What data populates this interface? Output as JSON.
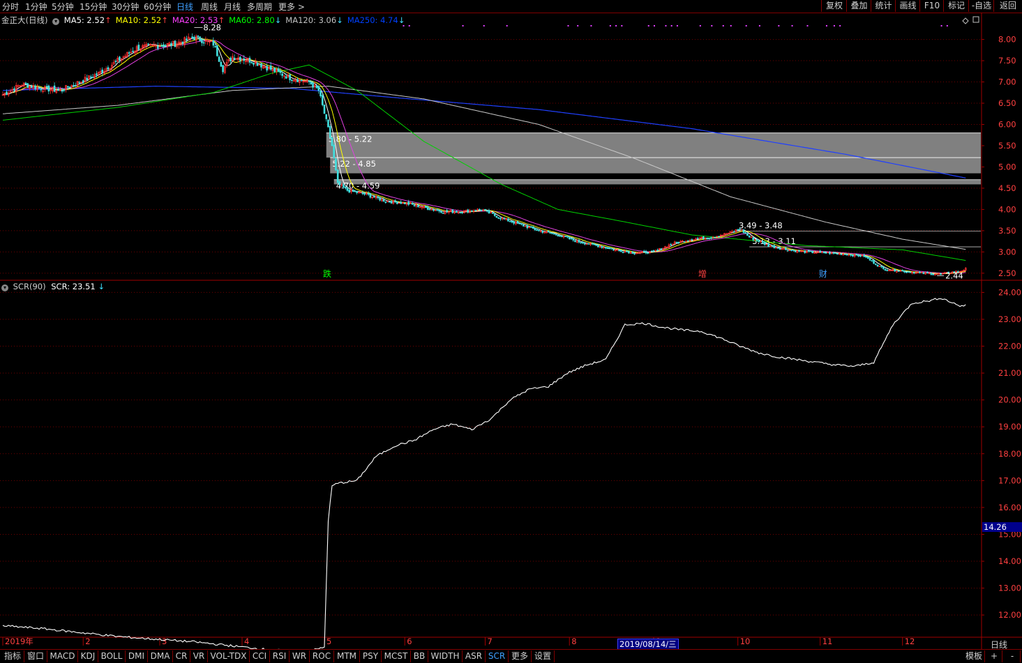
{
  "periods": [
    "分时",
    "1分钟",
    "5分钟",
    "15分钟",
    "30分钟",
    "60分钟",
    "日线",
    "周线",
    "月线",
    "多周期",
    "更多 >"
  ],
  "active_period": "日线",
  "right_buttons": [
    "复权",
    "叠加",
    "统计",
    "画线",
    "F10",
    "标记",
    "-自选",
    "返回"
  ],
  "chart_title": "金正大(日线)",
  "ma_legend": [
    {
      "label": "MA5: 2.52",
      "arrow": "↑",
      "color": "#ffffff"
    },
    {
      "label": "MA10: 2.52",
      "arrow": "↑",
      "color": "#ffff00"
    },
    {
      "label": "MA20: 2.53",
      "arrow": "↑",
      "color": "#ff40ff"
    },
    {
      "label": "MA60: 2.80",
      "arrow": "↓",
      "color": "#00ff00"
    },
    {
      "label": "MA120: 3.06",
      "arrow": "↓",
      "color": "#c0c0c0"
    },
    {
      "label": "MA250: 4.74",
      "arrow": "↓",
      "color": "#0040ff"
    }
  ],
  "indicator_legend": {
    "name": "SCR(90)",
    "value": "SCR: 23.51",
    "arrow": "↓"
  },
  "current_value_tag": "14.26",
  "cursor_date": "2019/08/14/三",
  "bottom_right_label": "日线",
  "tabs": [
    "指标",
    "窗口",
    "MACD",
    "KDJ",
    "BOLL",
    "DMI",
    "DMA",
    "CR",
    "VR",
    "VOL-TDX",
    "CCI",
    "RSI",
    "WR",
    "ROC",
    "MTM",
    "PSY",
    "MCST",
    "BB",
    "WIDTH",
    "ASR",
    "SCR",
    "更多",
    "设置"
  ],
  "active_tab": "SCR",
  "tabs_right": [
    "模板",
    "+",
    "-"
  ],
  "chart_data": [
    {
      "type": "candlestick",
      "title": "金正大(日线)",
      "y_ticks": [
        2.5,
        3.0,
        3.5,
        4.0,
        4.5,
        5.0,
        5.5,
        6.0,
        6.5,
        7.0,
        7.5,
        8.0
      ],
      "ylim": [
        2.35,
        8.6
      ],
      "high_annotation": "8.28",
      "low_annotation": "2.44",
      "gap_zones": [
        {
          "label": "5.80 - 5.22",
          "high": 5.8,
          "low": 5.22
        },
        {
          "label": "5.22 - 4.85",
          "high": 5.22,
          "low": 4.85
        },
        {
          "label": "4.70 - 4.59",
          "high": 4.7,
          "low": 4.59
        }
      ],
      "level_lines": [
        {
          "label": "3.49 - 3.48",
          "value": 3.49
        },
        {
          "label": "3.13 - 3.11",
          "value": 3.12
        }
      ],
      "event_markers": [
        {
          "label": "跌",
          "color": "#00ff00"
        },
        {
          "label": "增",
          "color": "#ff4040"
        },
        {
          "label": "财",
          "color": "#40a0ff"
        }
      ],
      "x_months": [
        "2019年",
        "2",
        "3",
        "4",
        "5",
        "6",
        "7",
        "8",
        "9",
        "10",
        "11",
        "12"
      ],
      "close_anchors": [
        [
          0,
          6.7
        ],
        [
          10,
          6.95
        ],
        [
          20,
          6.85
        ],
        [
          30,
          6.8
        ],
        [
          40,
          7.0
        ],
        [
          50,
          7.2
        ],
        [
          60,
          7.5
        ],
        [
          70,
          7.8
        ],
        [
          80,
          7.85
        ],
        [
          90,
          7.9
        ],
        [
          100,
          8.05
        ],
        [
          110,
          7.9
        ],
        [
          115,
          7.3
        ],
        [
          120,
          7.6
        ],
        [
          130,
          7.5
        ],
        [
          140,
          7.3
        ],
        [
          150,
          7.1
        ],
        [
          160,
          7.0
        ],
        [
          165,
          6.8
        ],
        [
          170,
          5.9
        ],
        [
          172,
          5.5
        ],
        [
          175,
          4.6
        ],
        [
          180,
          4.45
        ],
        [
          190,
          4.35
        ],
        [
          200,
          4.2
        ],
        [
          210,
          4.15
        ],
        [
          220,
          4.05
        ],
        [
          230,
          3.95
        ],
        [
          240,
          3.95
        ],
        [
          250,
          4.0
        ],
        [
          260,
          3.8
        ],
        [
          270,
          3.65
        ],
        [
          280,
          3.5
        ],
        [
          290,
          3.4
        ],
        [
          300,
          3.25
        ],
        [
          310,
          3.15
        ],
        [
          320,
          3.05
        ],
        [
          330,
          2.98
        ],
        [
          340,
          3.0
        ],
        [
          350,
          3.2
        ],
        [
          360,
          3.3
        ],
        [
          370,
          3.35
        ],
        [
          380,
          3.45
        ],
        [
          385,
          3.55
        ],
        [
          390,
          3.35
        ],
        [
          400,
          3.15
        ],
        [
          410,
          3.05
        ],
        [
          420,
          3.0
        ],
        [
          430,
          2.98
        ],
        [
          440,
          2.95
        ],
        [
          450,
          2.9
        ],
        [
          455,
          2.75
        ],
        [
          460,
          2.6
        ],
        [
          470,
          2.55
        ],
        [
          480,
          2.5
        ],
        [
          490,
          2.48
        ],
        [
          500,
          2.55
        ],
        [
          503,
          2.6
        ]
      ],
      "ma250_anchors": [
        [
          0,
          6.8
        ],
        [
          80,
          6.9
        ],
        [
          150,
          6.85
        ],
        [
          200,
          6.65
        ],
        [
          280,
          6.35
        ],
        [
          360,
          5.9
        ],
        [
          440,
          5.3
        ],
        [
          503,
          4.74
        ]
      ],
      "ma120_anchors": [
        [
          0,
          6.25
        ],
        [
          60,
          6.45
        ],
        [
          120,
          6.8
        ],
        [
          170,
          6.9
        ],
        [
          220,
          6.6
        ],
        [
          280,
          6.0
        ],
        [
          330,
          5.2
        ],
        [
          380,
          4.3
        ],
        [
          430,
          3.7
        ],
        [
          470,
          3.3
        ],
        [
          503,
          3.06
        ]
      ],
      "ma60_anchors": [
        [
          0,
          6.1
        ],
        [
          60,
          6.4
        ],
        [
          110,
          6.75
        ],
        [
          140,
          7.2
        ],
        [
          160,
          7.4
        ],
        [
          185,
          6.8
        ],
        [
          220,
          5.6
        ],
        [
          260,
          4.6
        ],
        [
          290,
          4.0
        ],
        [
          320,
          3.75
        ],
        [
          360,
          3.4
        ],
        [
          420,
          3.15
        ],
        [
          470,
          3.05
        ],
        [
          503,
          2.8
        ]
      ]
    },
    {
      "type": "line",
      "title": "SCR(90)",
      "y_ticks": [
        12.0,
        13.0,
        14.0,
        15.0,
        16.0,
        17.0,
        18.0,
        19.0,
        20.0,
        21.0,
        22.0,
        23.0,
        24.0
      ],
      "ylim": [
        11.2,
        24.4
      ],
      "anchors": [
        [
          0,
          11.6
        ],
        [
          20,
          11.5
        ],
        [
          40,
          11.35
        ],
        [
          60,
          11.2
        ],
        [
          80,
          11.1
        ],
        [
          100,
          11.0
        ],
        [
          120,
          10.85
        ],
        [
          140,
          10.7
        ],
        [
          160,
          10.65
        ],
        [
          168,
          10.8
        ],
        [
          170,
          15.5
        ],
        [
          172,
          16.8
        ],
        [
          175,
          16.9
        ],
        [
          185,
          17.0
        ],
        [
          195,
          17.9
        ],
        [
          205,
          18.3
        ],
        [
          215,
          18.5
        ],
        [
          225,
          18.9
        ],
        [
          235,
          19.1
        ],
        [
          245,
          18.9
        ],
        [
          255,
          19.3
        ],
        [
          265,
          20.0
        ],
        [
          275,
          20.4
        ],
        [
          285,
          20.5
        ],
        [
          295,
          21.0
        ],
        [
          305,
          21.3
        ],
        [
          315,
          21.5
        ],
        [
          325,
          22.8
        ],
        [
          335,
          22.85
        ],
        [
          345,
          22.7
        ],
        [
          355,
          22.6
        ],
        [
          365,
          22.55
        ],
        [
          375,
          22.3
        ],
        [
          385,
          22.0
        ],
        [
          395,
          21.75
        ],
        [
          405,
          21.6
        ],
        [
          415,
          21.5
        ],
        [
          425,
          21.4
        ],
        [
          435,
          21.3
        ],
        [
          445,
          21.25
        ],
        [
          455,
          21.4
        ],
        [
          465,
          22.8
        ],
        [
          475,
          23.6
        ],
        [
          485,
          23.7
        ],
        [
          490,
          23.8
        ],
        [
          500,
          23.5
        ],
        [
          503,
          23.51
        ]
      ]
    }
  ]
}
